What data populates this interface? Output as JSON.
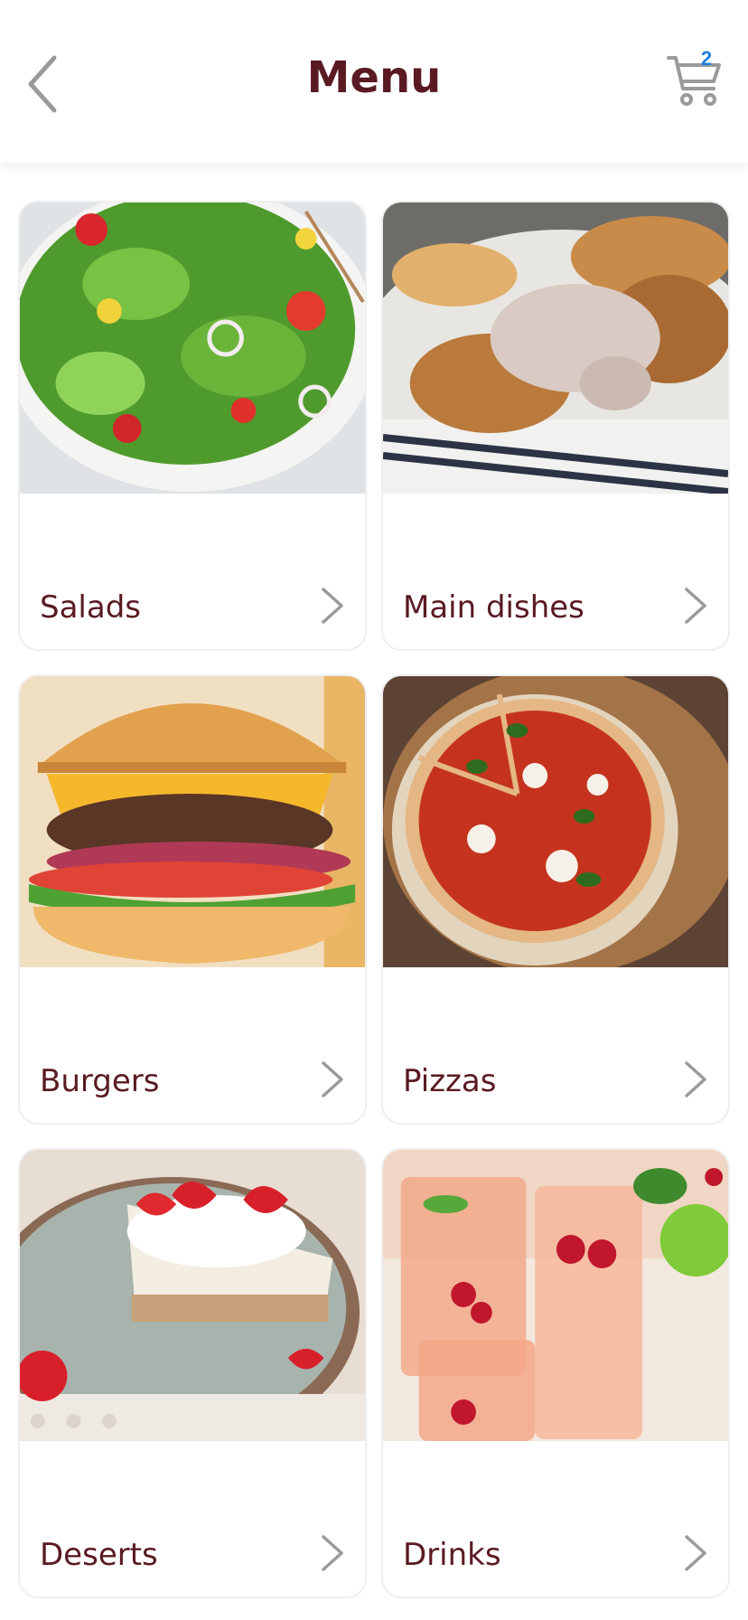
{
  "header": {
    "title": "Menu",
    "cart_count": "2"
  },
  "categories": [
    {
      "label": "Salads",
      "image": "salad-photo"
    },
    {
      "label": "Main dishes",
      "image": "main-dish-photo"
    },
    {
      "label": "Burgers",
      "image": "burger-photo"
    },
    {
      "label": "Pizzas",
      "image": "pizza-photo"
    },
    {
      "label": "Deserts",
      "image": "dessert-photo"
    },
    {
      "label": "Drinks",
      "image": "drinks-photo"
    }
  ],
  "colors": {
    "accent": "#5a1a22",
    "badge": "#1e7fd8",
    "icon_gray": "#9a9a9a"
  }
}
